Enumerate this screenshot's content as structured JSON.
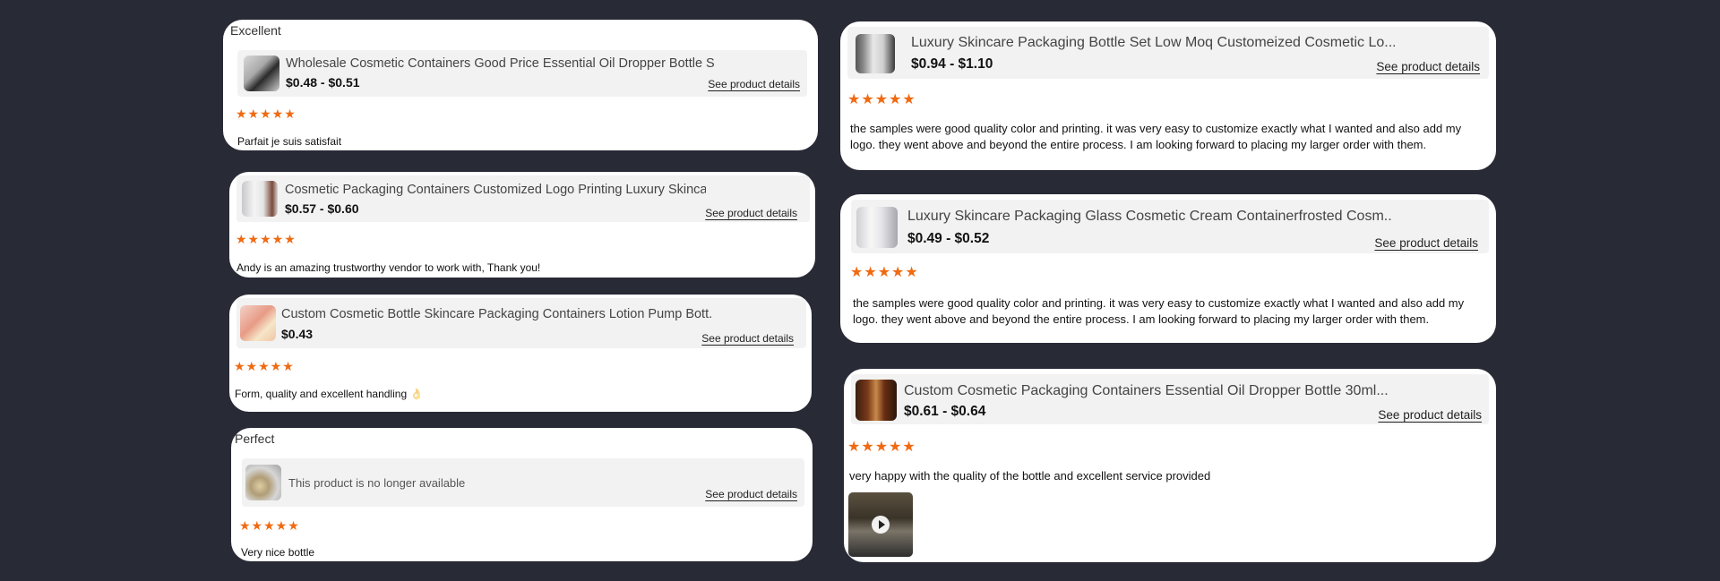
{
  "common": {
    "see_details": "See product details",
    "stars": "★★★★★"
  },
  "colors": {
    "background": "#282a36",
    "card": "#ffffff",
    "product_box": "#f2f2f2",
    "star": "#f06a12"
  },
  "left_reviews": [
    {
      "title": "Excellent",
      "product_name": "Wholesale Cosmetic Containers Good Price Essential Oil Dropper Bottle S...",
      "price": "$0.48 - $0.51",
      "rating": 5,
      "text": "Parfait je suis satisfait"
    },
    {
      "title": "",
      "product_name": "Cosmetic Packaging Containers Customized Logo Printing Luxury Skincar...",
      "price": "$0.57 - $0.60",
      "rating": 5,
      "text": "Andy is an amazing trustworthy vendor to work with, Thank you!"
    },
    {
      "title": "",
      "product_name": "Custom Cosmetic Bottle Skincare Packaging Containers Lotion Pump Bott...",
      "price": "$0.43",
      "rating": 5,
      "text": "Form, quality and excellent handling",
      "emoji": "👌"
    },
    {
      "title": "Perfect",
      "product_name": "This product is no longer available",
      "price": "",
      "rating": 5,
      "text": "Very nice bottle"
    }
  ],
  "right_reviews": [
    {
      "product_name": "Luxury Skincare Packaging Bottle Set Low Moq Customeized Cosmetic Lo...",
      "price": "$0.94 - $1.10",
      "rating": 5,
      "text": "the samples were good quality color and printing. it was very easy to customize exactly what I wanted and also add my logo. they went above and beyond the entire process. I am looking forward to placing my larger order with them."
    },
    {
      "product_name": "Luxury Skincare Packaging Glass Cosmetic Cream Containerfrosted Cosm...",
      "price": "$0.49 - $0.52",
      "rating": 5,
      "text": "the samples were good quality color and printing. it was very easy to customize exactly what I wanted and also add my logo. they went above and beyond the entire process. I am looking forward to placing my larger order with them."
    },
    {
      "product_name": "Custom Cosmetic Packaging Containers Essential Oil Dropper Bottle 30ml...",
      "price": "$0.61 - $0.64",
      "rating": 5,
      "text": "very happy with the quality of the bottle and excellent service provided",
      "has_video": true,
      "video_icon": "play-icon"
    }
  ]
}
